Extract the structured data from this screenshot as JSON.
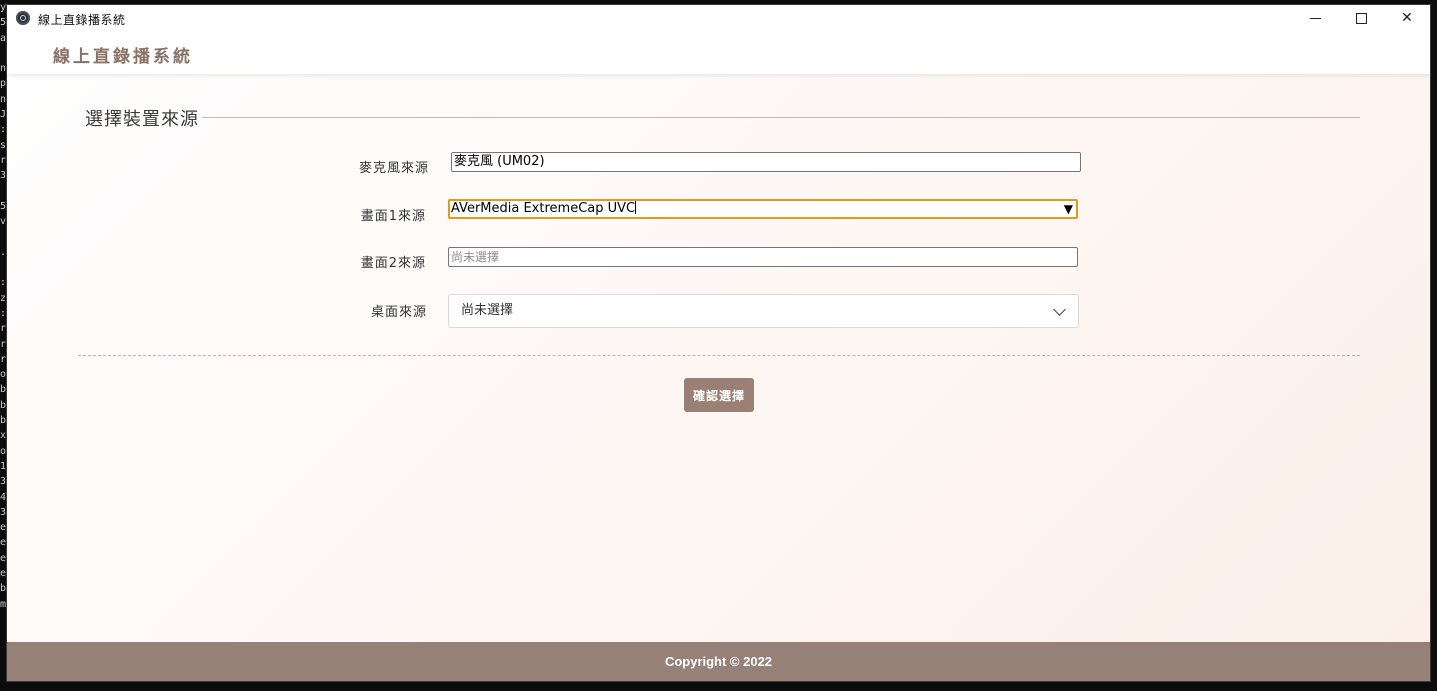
{
  "window": {
    "title": "線上直錄播系統",
    "minimize_glyph": "—",
    "close_glyph": "✕"
  },
  "header": {
    "brand": "線上直錄播系統"
  },
  "section": {
    "title": "選擇裝置來源"
  },
  "form": {
    "mic": {
      "label": "麥克風來源",
      "value": "麥克風 (UM02)"
    },
    "screen1": {
      "label": "畫面1來源",
      "value": "AVerMedia ExtremeCap UVC",
      "caret": "▼"
    },
    "screen2": {
      "label": "畫面2來源",
      "placeholder": "尚未選擇"
    },
    "desktop": {
      "label": "桌面來源",
      "value": "尚未選擇"
    }
  },
  "actions": {
    "confirm_label": "確認選擇"
  },
  "footer": {
    "copyright": "Copyright © 2022"
  },
  "colors": {
    "accent": "#9a7f74",
    "footer_bg": "#968179",
    "brand": "#8a7268",
    "focus": "#e09a1f"
  }
}
